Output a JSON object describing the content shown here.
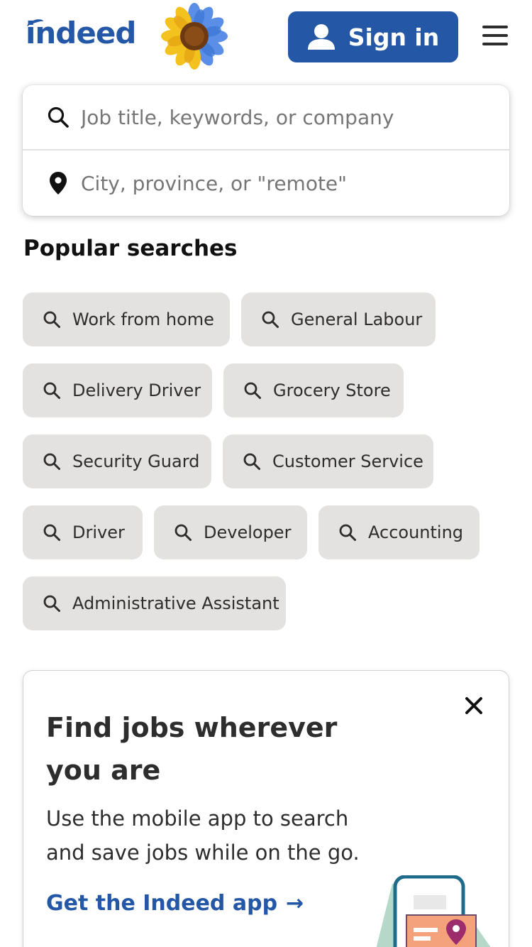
{
  "header": {
    "logo_text": "indeed",
    "sign_in_label": "Sign in"
  },
  "search": {
    "what_placeholder": "Job title, keywords, or company",
    "where_placeholder": "City, province, or \"remote\""
  },
  "popular": {
    "title": "Popular searches",
    "items": [
      "Work from home",
      "General Labour",
      "Delivery Driver",
      "Grocery Store",
      "Security Guard",
      "Customer Service",
      "Driver",
      "Developer",
      "Accounting",
      "Administrative Assistant"
    ]
  },
  "promo": {
    "title": "Find jobs wherever you are",
    "body": "Use the mobile app to search and save jobs while on the go.",
    "cta": "Get the Indeed app",
    "cta_arrow": "→"
  },
  "colors": {
    "brand_blue": "#2557a7",
    "chip_bg": "#e4e2e0",
    "text_dark": "#2d2d2d"
  }
}
